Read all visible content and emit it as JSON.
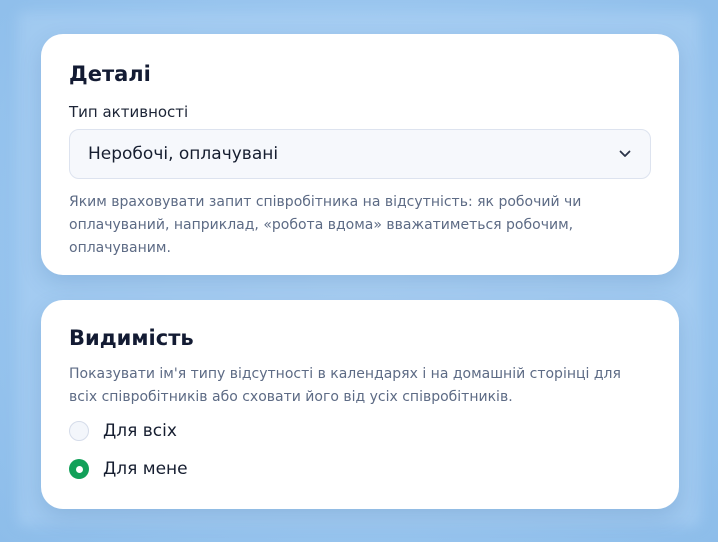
{
  "details": {
    "title": "Деталі",
    "activity_type_label": "Тип активності",
    "activity_type_value": "Неробочі, оплачувані",
    "help_text": "Яким враховувати запит співробітника на відсутність: як робочий чи оплачуваний, наприклад, «робота вдома» вважатиметься робочим, оплачуваним."
  },
  "visibility": {
    "title": "Видимість",
    "help_text": "Показувати ім'я типу відсутності в календарях і на домашній сторінці для всіх співробітників або сховати його від усіх співробітників.",
    "options": [
      {
        "label": "Для всіх",
        "selected": false
      },
      {
        "label": "Для мене",
        "selected": true
      }
    ]
  },
  "colors": {
    "accent_green": "#12a059",
    "title_text": "#131b33",
    "help_text": "#5d6b85"
  },
  "icons": {
    "select_chevron": "chevron-down-icon"
  }
}
